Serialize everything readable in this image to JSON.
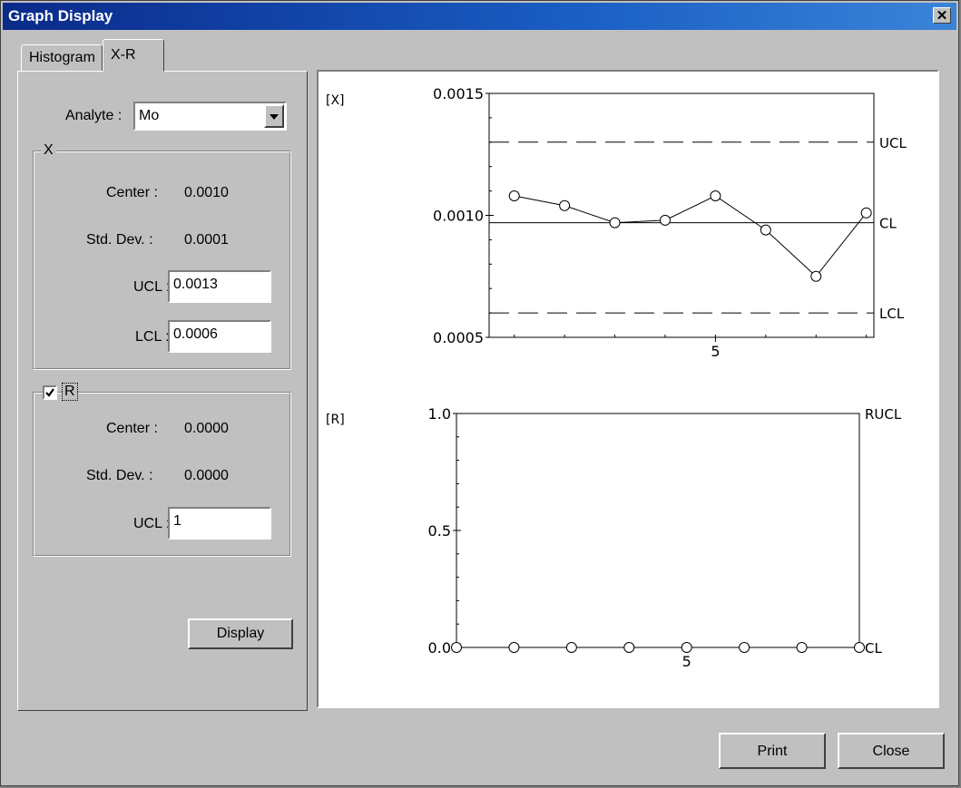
{
  "window": {
    "title": "Graph Display",
    "close_glyph": "✕"
  },
  "tabs": [
    {
      "label": "Histogram"
    },
    {
      "label": "X-R"
    }
  ],
  "form": {
    "analyte_label": "Analyte :",
    "analyte_value": "Mo",
    "x_group": {
      "title": "X",
      "center_label": "Center :",
      "center_value": "0.0010",
      "stddev_label": "Std. Dev. :",
      "stddev_value": "0.0001",
      "ucl_label": "UCL :",
      "ucl_value": "0.0013",
      "lcl_label": "LCL :",
      "lcl_value": "0.0006"
    },
    "r_group": {
      "title": "R",
      "checked": true,
      "center_label": "Center :",
      "center_value": "0.0000",
      "stddev_label": "Std. Dev. :",
      "stddev_value": "0.0000",
      "ucl_label": "UCL :",
      "ucl_value": "1"
    },
    "display_button": "Display"
  },
  "footer": {
    "print_button": "Print",
    "close_button": "Close"
  },
  "chart_data": [
    {
      "type": "line",
      "label": "[X]",
      "x": [
        1,
        2,
        3,
        4,
        5,
        6,
        7,
        8
      ],
      "values": [
        0.00108,
        0.00104,
        0.00097,
        0.00098,
        0.00108,
        0.00094,
        0.00075,
        0.00101
      ],
      "ylim": [
        0.0005,
        0.0015
      ],
      "xlim": [
        0.5,
        8.15
      ],
      "yticks": [
        "0.0015",
        "0.0010",
        "0.0005"
      ],
      "ytick_values": [
        0.0015,
        0.001,
        0.0005
      ],
      "xticks": [
        "5"
      ],
      "xtick_values": [
        5
      ],
      "lines": [
        {
          "name": "UCL",
          "value": 0.0013,
          "style": "dashed"
        },
        {
          "name": "CL",
          "value": 0.00097,
          "style": "solid"
        },
        {
          "name": "LCL",
          "value": 0.0006,
          "style": "dashed"
        }
      ]
    },
    {
      "type": "line",
      "label": "[R]",
      "x": [
        1,
        2,
        3,
        4,
        5,
        6,
        7,
        8
      ],
      "values": [
        0,
        0,
        0,
        0,
        0,
        0,
        0,
        0
      ],
      "ylim": [
        0.0,
        1.0
      ],
      "xlim": [
        1,
        8
      ],
      "yticks": [
        "1.0",
        "0.5",
        "0.0"
      ],
      "ytick_values": [
        1.0,
        0.5,
        0.0
      ],
      "xticks": [
        "5"
      ],
      "xtick_values": [
        5
      ],
      "lines": [
        {
          "name": "RUCL",
          "value": 1.0,
          "style": "dashed"
        },
        {
          "name": "CL",
          "value": 0.0,
          "style": "solid"
        }
      ]
    }
  ]
}
